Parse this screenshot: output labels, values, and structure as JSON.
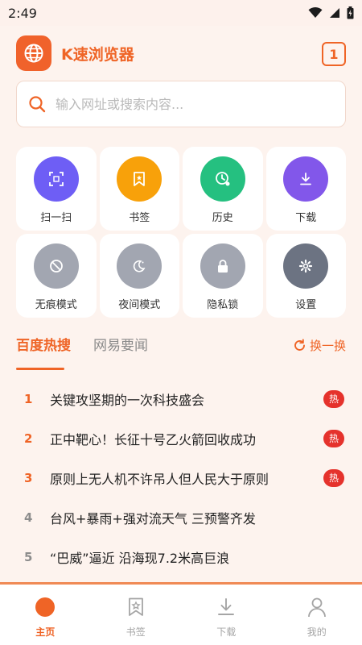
{
  "status_bar": {
    "time": "2:49",
    "icons": [
      "wifi-icon",
      "cellular-icon",
      "battery-icon"
    ]
  },
  "header": {
    "app_title": "K速浏览器",
    "tab_count": "1",
    "logo_icon": "globe-icon"
  },
  "search": {
    "placeholder": "输入网址或搜索内容..."
  },
  "quick_actions": [
    {
      "label": "扫一扫",
      "icon": "scan-icon",
      "color": "#6e5ef5"
    },
    {
      "label": "书签",
      "icon": "bookmark-icon",
      "color": "#f8a10a"
    },
    {
      "label": "历史",
      "icon": "history-icon",
      "color": "#25c080"
    },
    {
      "label": "下载",
      "icon": "download-icon",
      "color": "#8257ea"
    },
    {
      "label": "无痕模式",
      "icon": "incognito-icon",
      "color": "#a2a6b1"
    },
    {
      "label": "夜间模式",
      "icon": "night-icon",
      "color": "#a2a6b1"
    },
    {
      "label": "隐私锁",
      "icon": "lock-icon",
      "color": "#a2a6b1"
    },
    {
      "label": "设置",
      "icon": "gear-icon",
      "color": "#6c7382"
    }
  ],
  "news_tabs": {
    "active": "百度热搜",
    "inactive": "网易要闻",
    "refresh": "换一换"
  },
  "hot_list": [
    {
      "rank": "1",
      "text": "关键攻坚期的一次科技盛会",
      "badge": "热"
    },
    {
      "rank": "2",
      "text": "正中靶心！长征十号乙火箭回收成功",
      "badge": "热"
    },
    {
      "rank": "3",
      "text": "原则上无人机不许吊人但人民大于原则",
      "badge": "热"
    },
    {
      "rank": "4",
      "text": "台风+暴雨+强对流天气 三预警齐发",
      "badge": ""
    },
    {
      "rank": "5",
      "text": "“巴威”逼近 沿海现7.2米高巨浪",
      "badge": ""
    }
  ],
  "bottom_nav": [
    {
      "label": "主页",
      "icon": "home-icon"
    },
    {
      "label": "书签",
      "icon": "bookmark-icon"
    },
    {
      "label": "下载",
      "icon": "download-icon"
    },
    {
      "label": "我的",
      "icon": "profile-icon"
    }
  ],
  "colors": {
    "accent": "#ef6426",
    "hot_badge": "#e5322c",
    "background": "#fdf3ee"
  }
}
